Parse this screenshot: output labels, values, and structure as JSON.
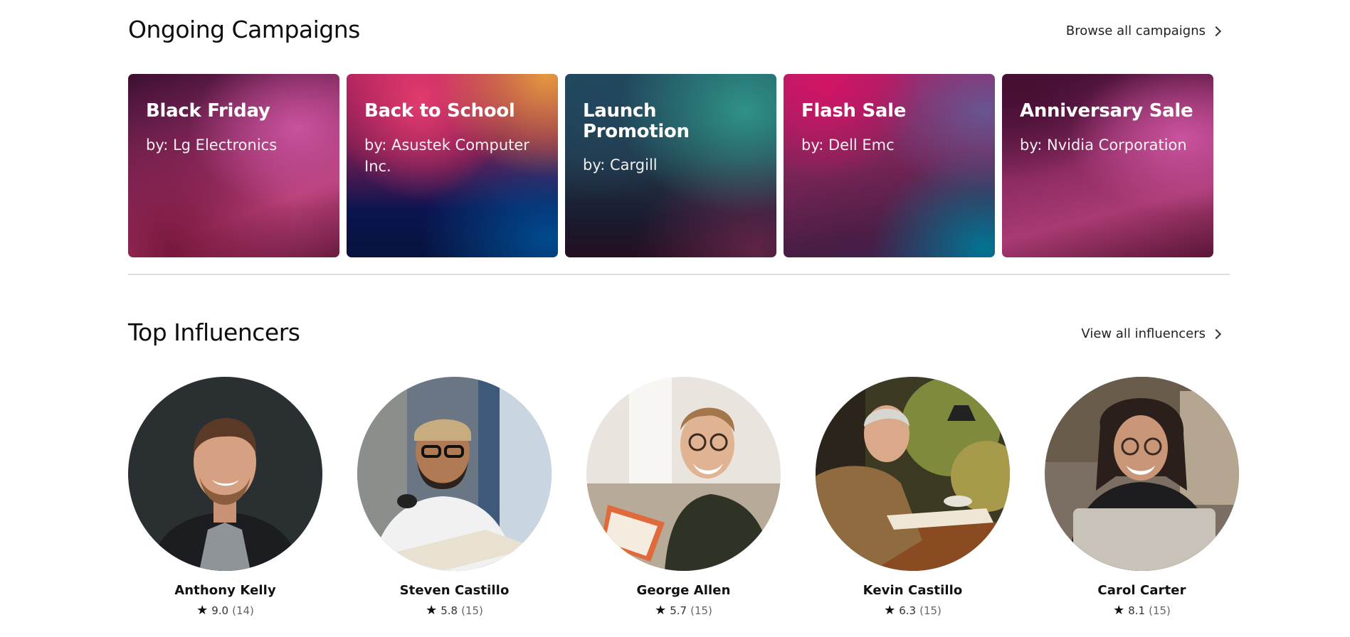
{
  "campaigns_section": {
    "title": "Ongoing Campaigns",
    "link_label": "Browse all campaigns"
  },
  "campaigns": [
    {
      "title": "Black Friday",
      "by": "by: Lg Electronics"
    },
    {
      "title": "Back to School",
      "by": "by: Asustek Computer Inc."
    },
    {
      "title": "Launch Promotion",
      "by": "by: Cargill"
    },
    {
      "title": "Flash Sale",
      "by": "by: Dell Emc"
    },
    {
      "title": "Anniversary Sale",
      "by": "by: Nvidia Corporation"
    }
  ],
  "influencers_section": {
    "title": "Top Influencers",
    "link_label": "View all influencers"
  },
  "influencers": [
    {
      "name": "Anthony Kelly",
      "rating": "9.0",
      "count": "(14)"
    },
    {
      "name": "Steven Castillo",
      "rating": "5.8",
      "count": "(15)"
    },
    {
      "name": "George Allen",
      "rating": "5.7",
      "count": "(15)"
    },
    {
      "name": "Kevin Castillo",
      "rating": "6.3",
      "count": "(15)"
    },
    {
      "name": "Carol Carter",
      "rating": "8.1",
      "count": "(15)"
    }
  ],
  "icons": {
    "chevron": "chevron-right-icon",
    "star": "star-icon"
  }
}
